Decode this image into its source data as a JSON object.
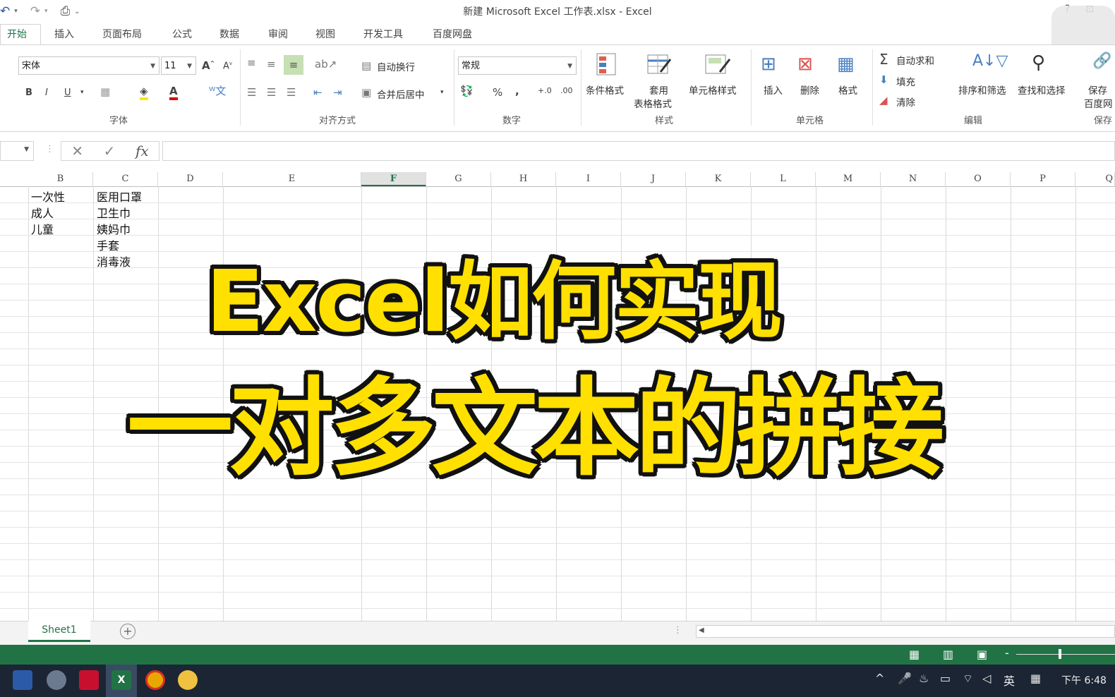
{
  "window": {
    "title": "新建 Microsoft Excel 工作表.xlsx - Excel",
    "help_icon": "?"
  },
  "tabs": [
    "开始",
    "插入",
    "页面布局",
    "公式",
    "数据",
    "审阅",
    "视图",
    "开发工具",
    "百度网盘"
  ],
  "ribbon": {
    "font_name": "宋体",
    "font_size": "11",
    "wrap_text": "自动换行",
    "merge_center": "合并后居中",
    "number_format": "常规",
    "cond_format": "条件格式",
    "table_format_1": "套用",
    "table_format_2": "表格格式",
    "cell_style": "单元格样式",
    "insert": "插入",
    "delete": "删除",
    "format": "格式",
    "autosum": "自动求和",
    "fill": "填充",
    "clear": "清除",
    "sort_filter": "排序和筛选",
    "find_select": "查找和选择",
    "save_1": "保存",
    "save_2": "百度网",
    "groups": {
      "font": "字体",
      "align": "对齐方式",
      "number": "数字",
      "styles": "样式",
      "cells": "单元格",
      "edit": "编辑",
      "save": "保存"
    }
  },
  "formula_bar": {
    "fx": "fx",
    "value": ""
  },
  "columns": [
    "B",
    "C",
    "D",
    "E",
    "F",
    "G",
    "H",
    "I",
    "J",
    "K",
    "L",
    "M",
    "N",
    "O",
    "P",
    "Q"
  ],
  "cells": {
    "b": [
      "一次性",
      "成人",
      "儿童"
    ],
    "c": [
      "医用口罩",
      "卫生巾",
      "姨妈巾",
      "手套",
      "消毒液"
    ]
  },
  "caption": {
    "line1": "Excel如何实现",
    "line2": "一对多文本的拼接"
  },
  "sheets": [
    "Sheet1"
  ],
  "taskbar": {
    "lang": "英",
    "time": "下午 6:48"
  }
}
